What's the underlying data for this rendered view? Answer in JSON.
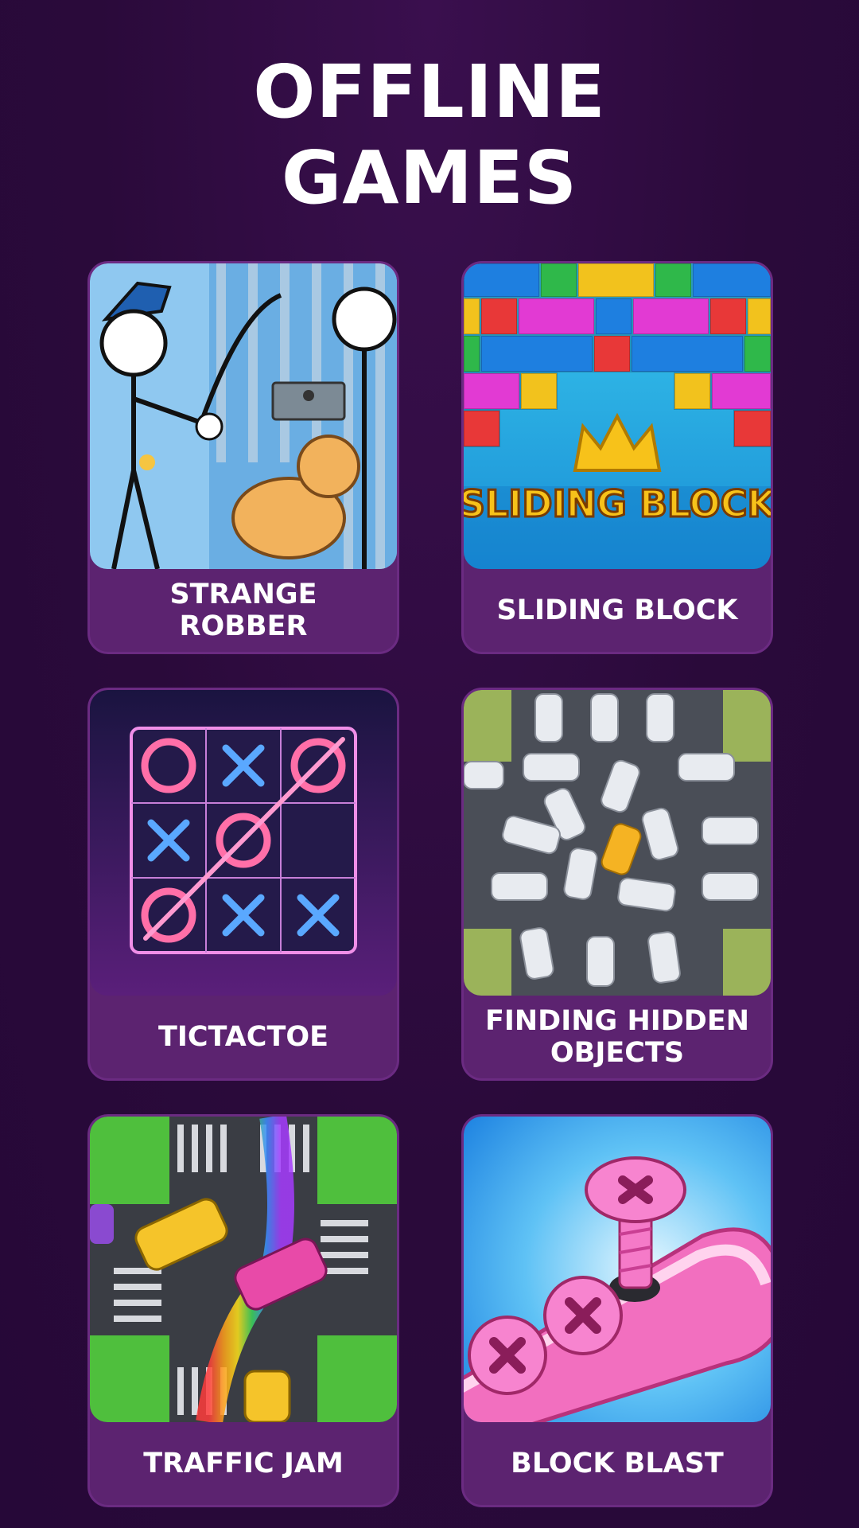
{
  "header": {
    "title_line1": "OFFLINE",
    "title_line2": "GAMES"
  },
  "games": [
    {
      "label": "STRANGE ROBBER",
      "icon": "stickman-jail-icon"
    },
    {
      "label": "SLIDING BLOCK",
      "icon": "colored-bricks-icon",
      "art_text": "SLIDING BLOCK"
    },
    {
      "label": "TICTACTOE",
      "icon": "neon-tictactoe-icon"
    },
    {
      "label": "FINDING HIDDEN OBJECTS",
      "icon": "parking-cars-icon"
    },
    {
      "label": "TRAFFIC JAM",
      "icon": "rainbow-taxi-icon"
    },
    {
      "label": "BLOCK BLAST",
      "icon": "pink-screws-icon"
    }
  ],
  "colors": {
    "background": "#2a0a3a",
    "card": "#5c2370",
    "text": "#ffffff"
  }
}
